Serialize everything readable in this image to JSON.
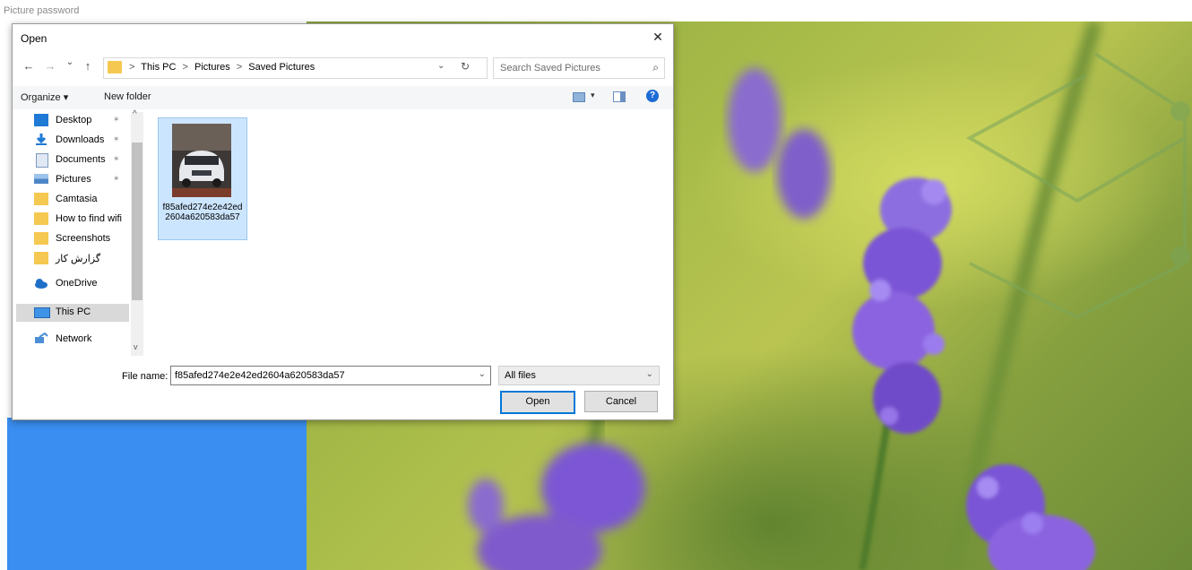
{
  "window": {
    "title": "Picture password"
  },
  "dialog": {
    "title": "Open",
    "close_glyph": "✕",
    "nav": {
      "back": "←",
      "forward": "→",
      "recent": "⌄",
      "up": "↑",
      "refresh": "↻",
      "dropdown": "⌄"
    },
    "breadcrumb": [
      "This PC",
      "Pictures",
      "Saved Pictures"
    ],
    "breadcrumb_sep": ">",
    "search_placeholder": "Search Saved Pictures",
    "search_glyph": "⌕",
    "toolbar": {
      "organize": "Organize ▾",
      "new_folder": "New folder",
      "view_dd": "▾",
      "help": "?"
    },
    "nav_items": [
      {
        "label": "Desktop",
        "icon": "desktop-icon",
        "pinned": true
      },
      {
        "label": "Downloads",
        "icon": "download-icon",
        "pinned": true
      },
      {
        "label": "Documents",
        "icon": "documents-icon",
        "pinned": true
      },
      {
        "label": "Pictures",
        "icon": "pictures-icon",
        "pinned": true
      },
      {
        "label": "Camtasia",
        "icon": "folder-icon",
        "pinned": false
      },
      {
        "label": "How to find wifi",
        "icon": "folder-icon",
        "pinned": false
      },
      {
        "label": "Screenshots",
        "icon": "folder-icon",
        "pinned": false
      },
      {
        "label": "گزارش کار",
        "icon": "folder-icon",
        "pinned": false
      },
      {
        "label": "OneDrive",
        "icon": "onedrive-icon",
        "pinned": false
      },
      {
        "label": "This PC",
        "icon": "this-pc-icon",
        "pinned": false,
        "selected": true
      },
      {
        "label": "Network",
        "icon": "network-icon",
        "pinned": false
      }
    ],
    "pin_glyph": "📌",
    "files": [
      {
        "name": "f85afed274e2e42ed2604a620583da57",
        "selected": true
      }
    ],
    "file_name_label": "File name:",
    "file_name_value": "f85afed274e2e42ed2604a620583da57",
    "file_type": "All files",
    "open_label": "Open",
    "cancel_label": "Cancel"
  },
  "colors": {
    "accent": "#0078d7",
    "blue_panel": "#3a8ef1",
    "selection": "#cce5ff",
    "folder": "#f5c851"
  }
}
